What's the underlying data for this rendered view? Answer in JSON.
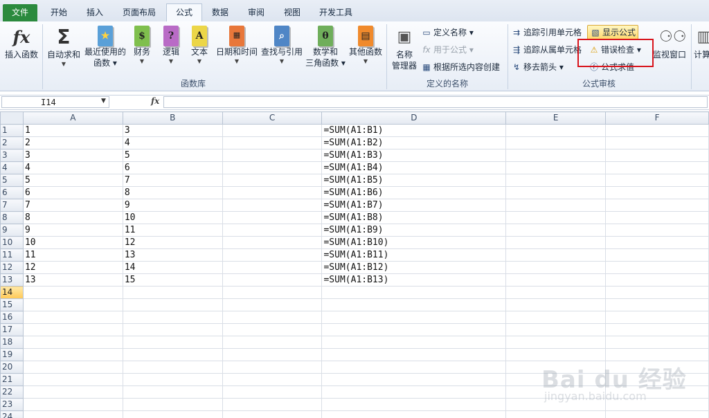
{
  "tabs": [
    "文件",
    "开始",
    "插入",
    "页面布局",
    "公式",
    "数据",
    "审阅",
    "视图",
    "开发工具"
  ],
  "ribbon": {
    "function_library": {
      "label": "函数库",
      "insert_function": "插入函数",
      "autosum": "自动求和",
      "recent": [
        "最近使用的",
        "函数"
      ],
      "financial": "财务",
      "logical": "逻辑",
      "text": "文本",
      "datetime": "日期和时间",
      "lookup": "查找与引用",
      "math": [
        "数学和",
        "三角函数"
      ],
      "more": "其他函数"
    },
    "defined_names": {
      "label": "定义的名称",
      "name_manager": [
        "名称",
        "管理器"
      ],
      "define_name": "定义名称",
      "use_in_formula": "用于公式",
      "create_from_selection": "根据所选内容创建"
    },
    "formula_auditing": {
      "label": "公式审核",
      "trace_precedents": "追踪引用单元格",
      "trace_dependents": "追踪从属单元格",
      "remove_arrows": "移去箭头",
      "show_formulas": "显示公式",
      "error_checking": "错误检查",
      "evaluate_formula": "公式求值",
      "watch_window": "监视窗口"
    },
    "calculation": {
      "label_partial": "计算"
    }
  },
  "formula_bar": {
    "name_box": "I14",
    "fx": "fx",
    "value": ""
  },
  "columns": [
    "A",
    "B",
    "C",
    "D",
    "E",
    "F"
  ],
  "rows": [
    {
      "n": "1",
      "a": "1",
      "b": "3",
      "d": "=SUM(A1:B1)"
    },
    {
      "n": "2",
      "a": "2",
      "b": "4",
      "d": "=SUM(A1:B2)"
    },
    {
      "n": "3",
      "a": "3",
      "b": "5",
      "d": "=SUM(A1:B3)"
    },
    {
      "n": "4",
      "a": "4",
      "b": "6",
      "d": "=SUM(A1:B4)"
    },
    {
      "n": "5",
      "a": "5",
      "b": "7",
      "d": "=SUM(A1:B5)"
    },
    {
      "n": "6",
      "a": "6",
      "b": "8",
      "d": "=SUM(A1:B6)"
    },
    {
      "n": "7",
      "a": "7",
      "b": "9",
      "d": "=SUM(A1:B7)"
    },
    {
      "n": "8",
      "a": "8",
      "b": "10",
      "d": "=SUM(A1:B8)"
    },
    {
      "n": "9",
      "a": "9",
      "b": "11",
      "d": "=SUM(A1:B9)"
    },
    {
      "n": "10",
      "a": "10",
      "b": "12",
      "d": "=SUM(A1:B10)"
    },
    {
      "n": "11",
      "a": "11",
      "b": "13",
      "d": "=SUM(A1:B11)"
    },
    {
      "n": "12",
      "a": "12",
      "b": "14",
      "d": "=SUM(A1:B12)"
    },
    {
      "n": "13",
      "a": "13",
      "b": "15",
      "d": "=SUM(A1:B13)"
    },
    {
      "n": "14",
      "a": "",
      "b": "",
      "d": ""
    },
    {
      "n": "15",
      "a": "",
      "b": "",
      "d": ""
    },
    {
      "n": "16",
      "a": "",
      "b": "",
      "d": ""
    },
    {
      "n": "17",
      "a": "",
      "b": "",
      "d": ""
    },
    {
      "n": "18",
      "a": "",
      "b": "",
      "d": ""
    },
    {
      "n": "19",
      "a": "",
      "b": "",
      "d": ""
    },
    {
      "n": "20",
      "a": "",
      "b": "",
      "d": ""
    },
    {
      "n": "21",
      "a": "",
      "b": "",
      "d": ""
    },
    {
      "n": "22",
      "a": "",
      "b": "",
      "d": ""
    },
    {
      "n": "23",
      "a": "",
      "b": "",
      "d": ""
    },
    {
      "n": "24",
      "a": "",
      "b": "",
      "d": ""
    }
  ],
  "selected_row": "14",
  "watermark": {
    "main": "Bai du 经验",
    "sub": "jingyan.baidu.com"
  },
  "colors": {
    "file_tab": "#2b8a3e",
    "highlight_box": "#d8131b",
    "selected_header": "#ffc957"
  }
}
